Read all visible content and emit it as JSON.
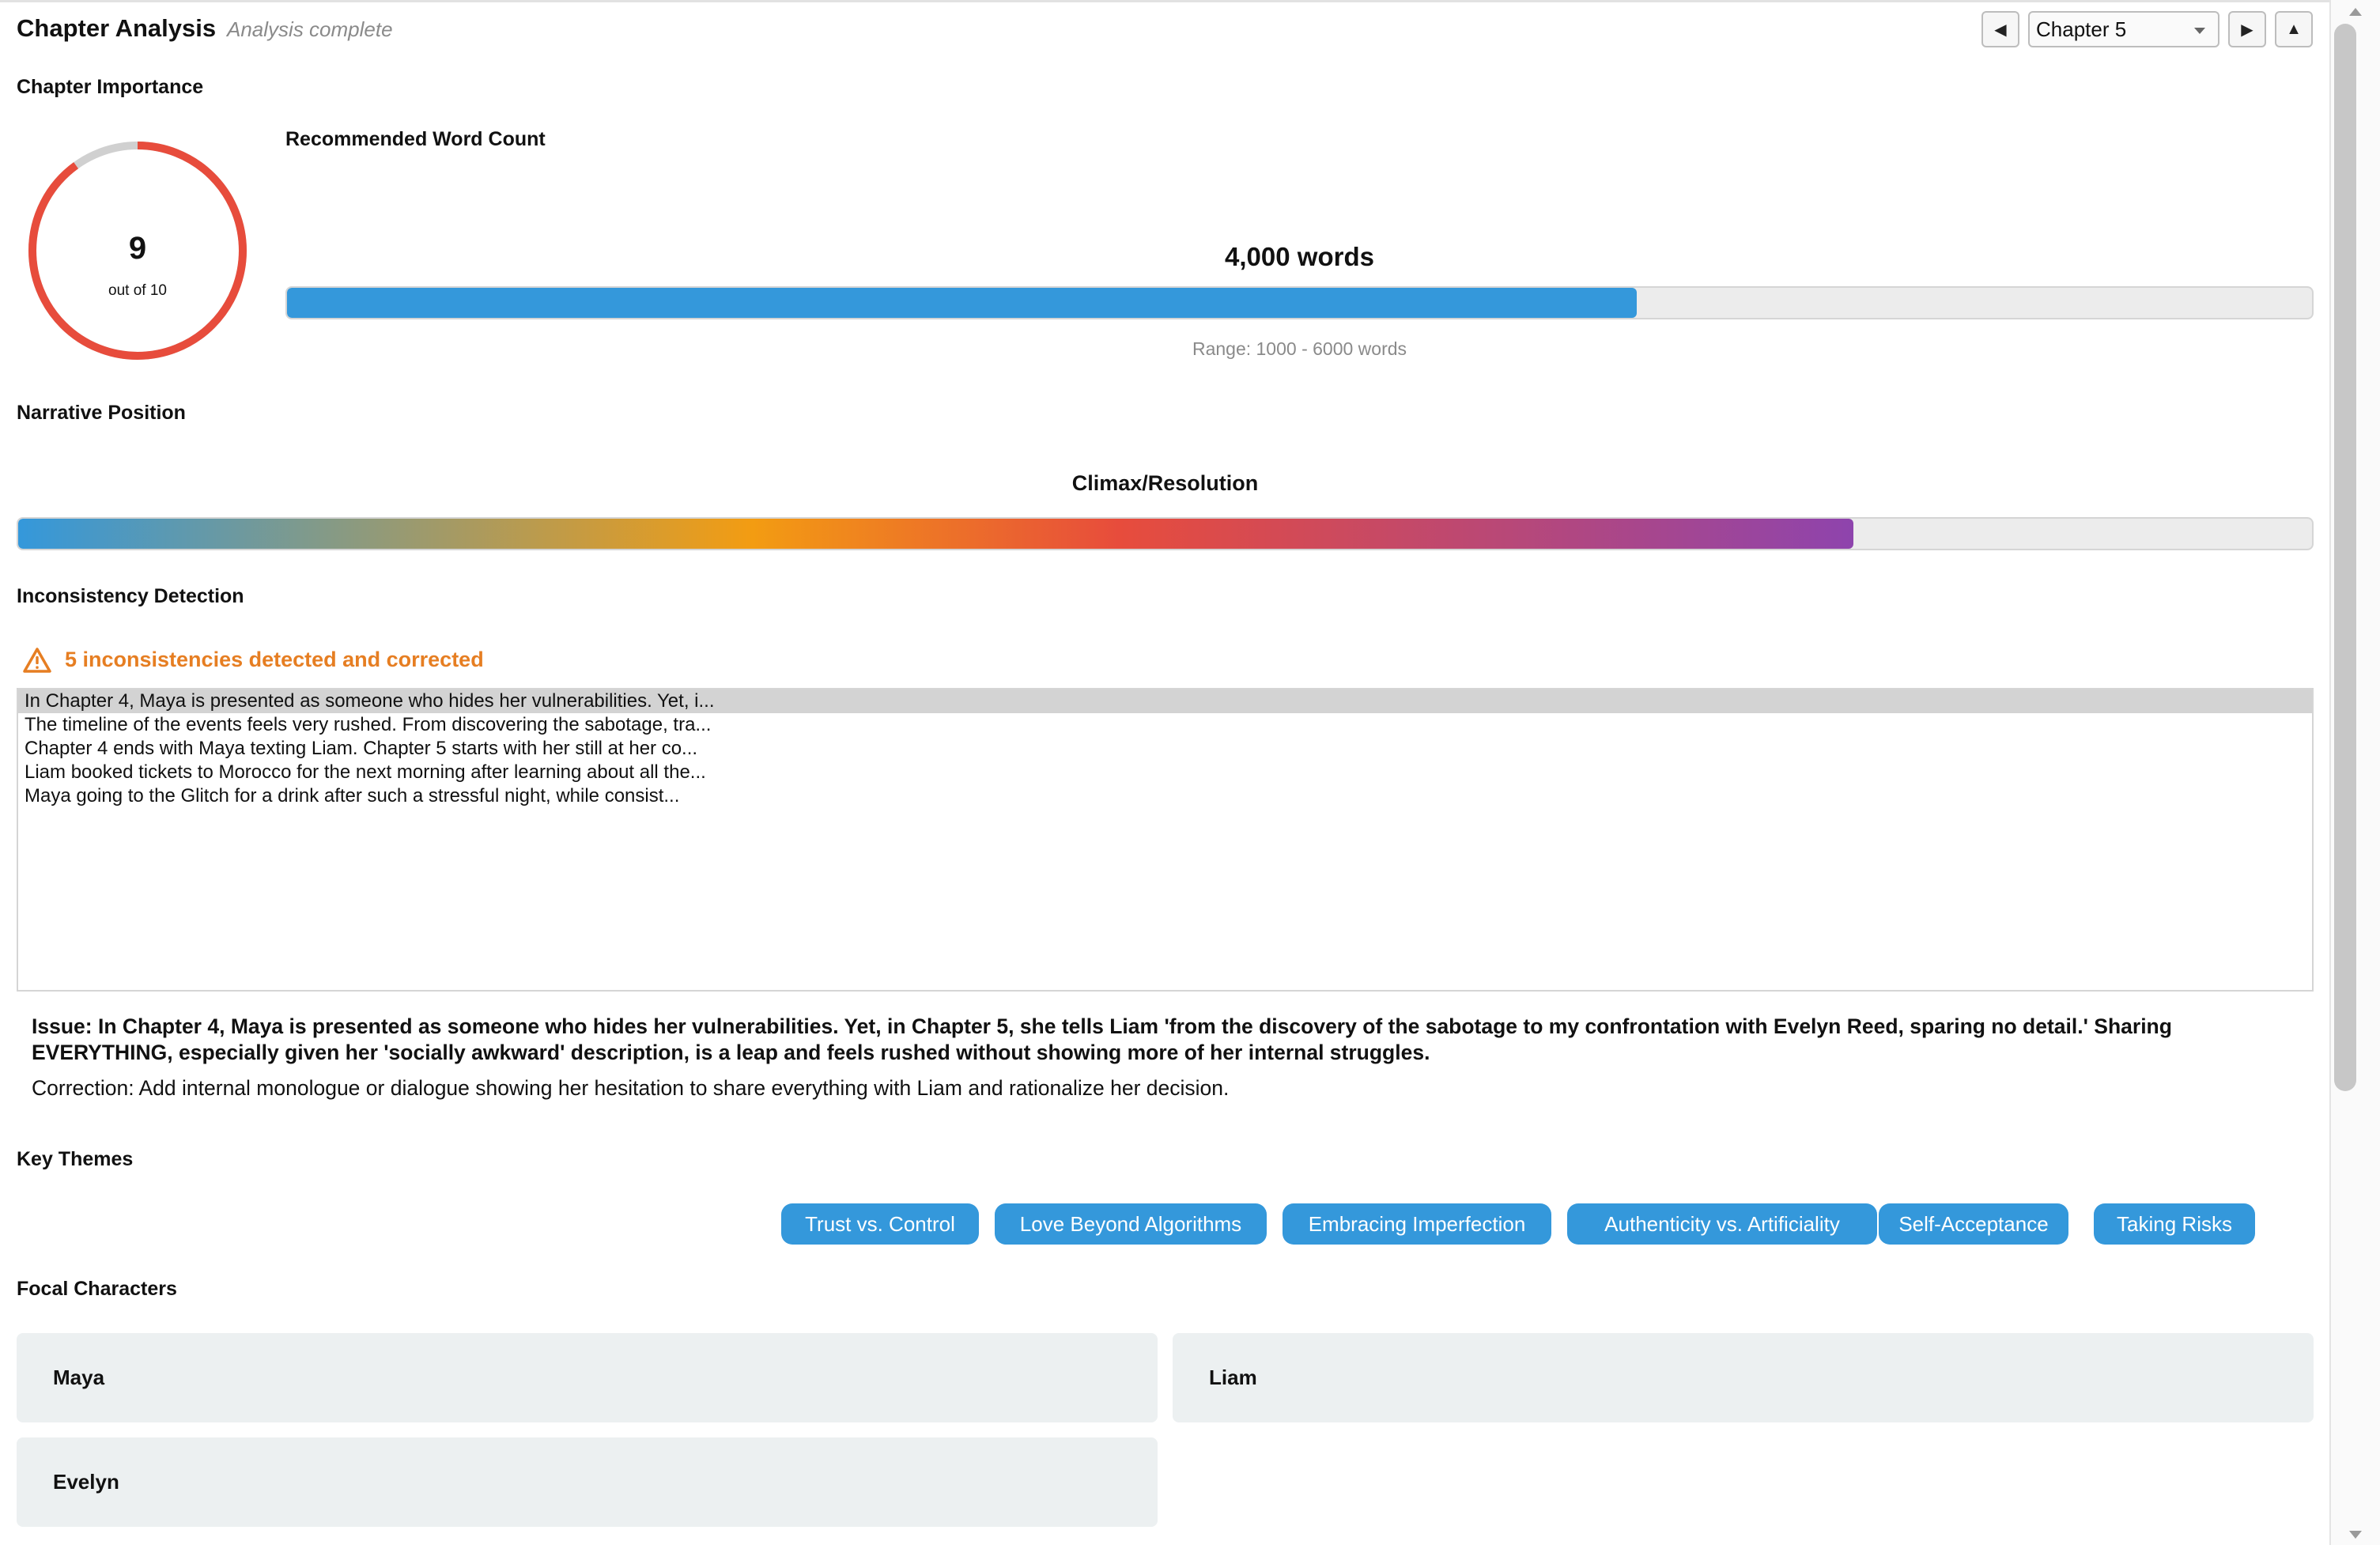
{
  "header": {
    "title": "Chapter Analysis",
    "status": "Analysis complete",
    "prev_icon": "◀",
    "next_icon": "▶",
    "collapse_icon": "▲",
    "chapter_select": {
      "selected": "Chapter 5"
    }
  },
  "importance": {
    "section_label": "Chapter Importance",
    "score": "9",
    "score_fraction": 0.9,
    "caption": "out of 10",
    "color": "#e74c3c"
  },
  "word_count": {
    "label": "Recommended Word Count",
    "value_text": "4,000 words",
    "value": 4000,
    "range_min": 1000,
    "range_max": 6000,
    "range_text": "Range: 1000 - 6000 words",
    "color": "#3498db"
  },
  "narrative": {
    "section_label": "Narrative Position",
    "value": "Climax/Resolution",
    "position_fraction": 0.8
  },
  "inconsistency": {
    "section_label": "Inconsistency Detection",
    "summary": "5 inconsistencies detected and corrected",
    "items": [
      "In Chapter 4, Maya is presented as someone who hides her vulnerabilities. Yet, i...",
      "The timeline of the events feels very rushed. From discovering the sabotage, tra...",
      "Chapter 4 ends with Maya texting Liam. Chapter 5 starts with her still at her co...",
      "Liam booked tickets to Morocco for the next morning after learning about all the...",
      "Maya going to the Glitch for a drink after such a stressful night, while consist..."
    ],
    "issue": "Issue: In Chapter 4, Maya is presented as someone who hides her vulnerabilities. Yet, in Chapter 5, she tells Liam 'from the discovery of the sabotage to my confrontation with Evelyn Reed, sparing no detail.' Sharing EVERYTHING, especially given her 'socially awkward' description, is a leap and feels rushed without showing more of her internal struggles.",
    "correction": "Correction: Add internal monologue or dialogue showing her hesitation to share everything with Liam and rationalize her decision."
  },
  "themes": {
    "section_label": "Key Themes",
    "items": [
      "Trust vs. Control",
      "Love Beyond Algorithms",
      "Embracing Imperfection",
      "Authenticity vs. Artificiality",
      "Self-Acceptance",
      "Taking Risks"
    ]
  },
  "characters": {
    "section_label": "Focal Characters",
    "items": [
      "Maya",
      "Liam",
      "Evelyn"
    ]
  }
}
